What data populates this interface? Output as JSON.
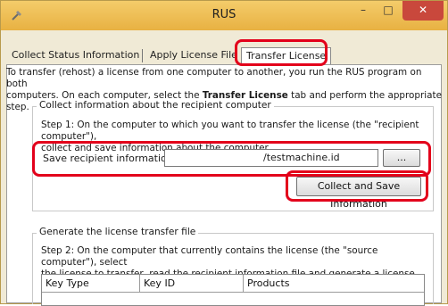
{
  "window": {
    "title": "RUS",
    "minimize_glyph": "–",
    "maximize_glyph": "□",
    "close_glyph": "✕"
  },
  "tabs": [
    {
      "label": "Collect Status Information"
    },
    {
      "label": "Apply License File"
    },
    {
      "label": "Transfer License",
      "selected": true
    }
  ],
  "intro": {
    "line1": "To transfer (rehost) a license from one computer to another, you run the RUS program on both",
    "line2_before": "computers. On each computer, select the ",
    "line2_bold": "Transfer License",
    "line2_after": " tab and perform the appropriate step."
  },
  "collect_group": {
    "title": "Collect information about the recipient computer",
    "step1_line1": "Step 1: On the computer to which you want to transfer the license (the \"recipient computer\"),",
    "step1_line2": "collect and save information about the computer.",
    "save_label": "Save recipient information to",
    "save_path": "/testmachine.id",
    "browse_label": "...",
    "collect_button_label": "Collect and Save Information"
  },
  "generate_group": {
    "title": "Generate the license transfer file",
    "step2_line1": "Step 2: On the computer that currently contains the license (the \"source computer\"), select",
    "step2_line2": "the license to transfer, read the recipient information file and generate a license transfer file.",
    "columns": [
      "Key Type",
      "Key ID",
      "Products"
    ]
  },
  "colors": {
    "titlebar": "#e8b142",
    "highlight": "#e3001b",
    "close_button": "#c9483c"
  }
}
